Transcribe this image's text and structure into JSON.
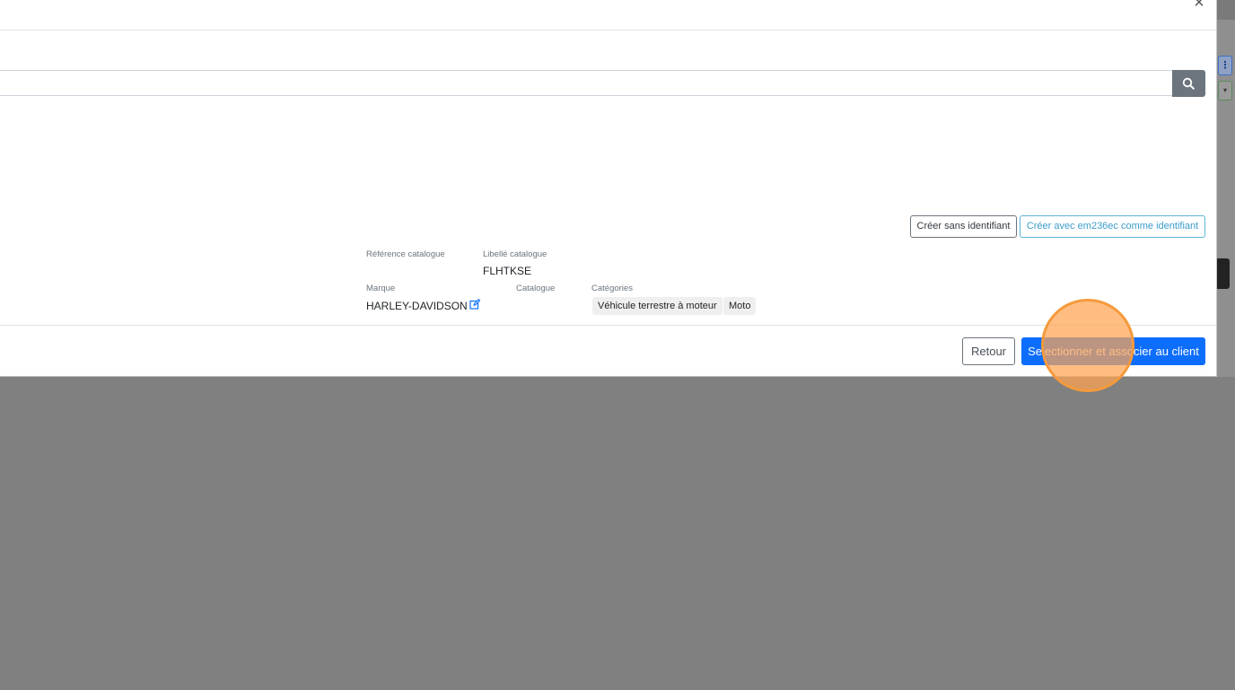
{
  "modal": {
    "close_label": "×",
    "search": {
      "value": "",
      "placeholder": ""
    },
    "actions": {
      "create_without_id": "Créer sans identifiant",
      "create_with_id": "Créer avec em236ec comme identifiant"
    },
    "product": {
      "ref_label": "Référence catalogue",
      "ref_value": "",
      "libelle_label": "Libellé catalogue",
      "libelle_value": "FLHTKSE",
      "brand_label": "Marque",
      "brand_value": "HARLEY-DAVIDSON",
      "catalogue_label": "Catalogue",
      "catalogue_value": "",
      "categories_label": "Catégories",
      "categories": [
        "Véhicule terrestre à moteur",
        "Moto"
      ]
    },
    "footer": {
      "back_label": "Retour",
      "primary_label": "Selectionner et associer au client"
    }
  },
  "background": {
    "kebab_icon": "kebab-vertical-icon",
    "select_caret": "▾"
  },
  "colors": {
    "primary": "#0d6efd",
    "info": "#3a9cc9",
    "backdrop": "#808080",
    "click_indicator": "#f59a3c"
  }
}
